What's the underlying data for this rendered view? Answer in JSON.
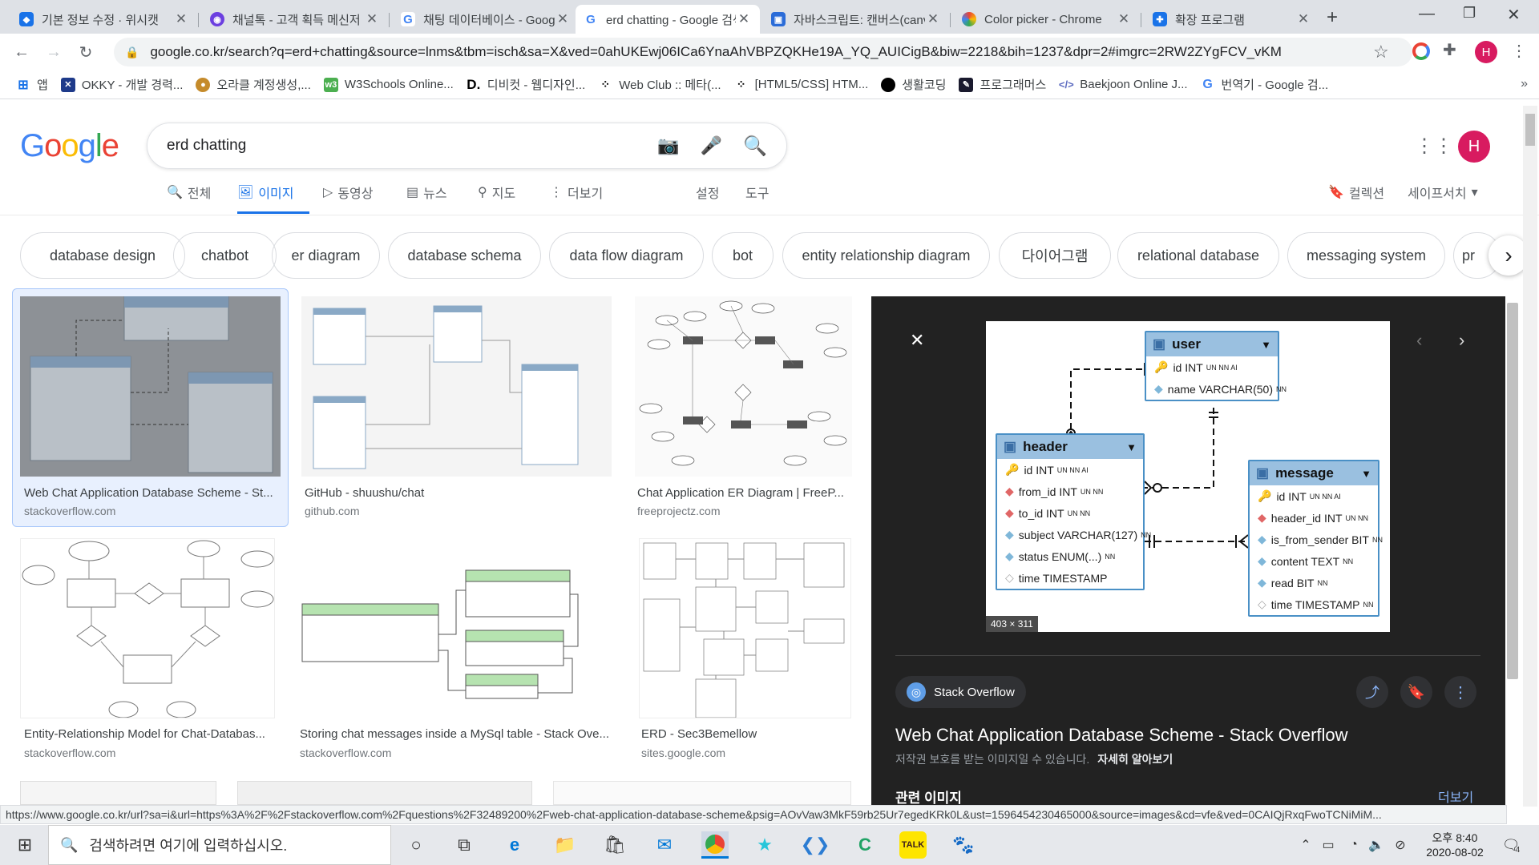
{
  "tabs": [
    {
      "title": "기본 정보 수정 · 위시캣",
      "color": "#1a73e8"
    },
    {
      "title": "채널톡 - 고객 획득 메신저",
      "color": "#6c3fe0"
    },
    {
      "title": "채팅 데이터베이스 - Google",
      "color": "#4285f4"
    },
    {
      "title": "erd chatting - Google 검색",
      "color": "#4285f4"
    },
    {
      "title": "자바스크립트: 캔버스(canvas)",
      "color": "#2b6cd8"
    },
    {
      "title": "Color picker - Chrome",
      "color": "#ea4335"
    },
    {
      "title": "확장 프로그램",
      "color": "#1a73e8"
    }
  ],
  "address": "google.co.kr/search?q=erd+chatting&source=lnms&tbm=isch&sa=X&ved=0ahUKEwj06ICa6YnaAhVBPZQKHe19A_YQ_AUICigB&biw=2218&bih=1237&dpr=2#imgrc=2RW2ZYgFCV_vKM",
  "profile_initial": "H",
  "bookmarks": [
    "앱",
    "OKKY - 개발 경력...",
    "오라클 계정생성,...",
    "W3Schools Online...",
    "디비컷 - 웹디자인...",
    "Web Club :: 메타(...",
    "[HTML5/CSS] HTM...",
    "생활코딩",
    "프로그래머스",
    "Baekjoon Online J...",
    "번역기 - Google 검..."
  ],
  "search": {
    "logo": "Google",
    "query": "erd chatting"
  },
  "menu": [
    "전체",
    "이미지",
    "동영상",
    "뉴스",
    "지도",
    "더보기"
  ],
  "menu_right": [
    "설정",
    "도구"
  ],
  "collections": "컬렉션",
  "safesearch": "세이프서치",
  "chips": [
    "database design",
    "chatbot",
    "er diagram",
    "database schema",
    "data flow diagram",
    "bot",
    "entity relationship diagram",
    "다이어그램",
    "relational database",
    "messaging system",
    "pr"
  ],
  "results": [
    {
      "title": "Web Chat Application Database Scheme - St...",
      "source": "stackoverflow.com"
    },
    {
      "title": "GitHub - shuushu/chat",
      "source": "github.com"
    },
    {
      "title": "Chat Application ER Diagram | FreeP...",
      "source": "freeprojectz.com"
    },
    {
      "title": "Entity-Relationship Model for Chat-Databas...",
      "source": "stackoverflow.com"
    },
    {
      "title": "Storing chat messages inside a MySql table - Stack Ove...",
      "source": "stackoverflow.com"
    },
    {
      "title": "ERD - Sec3Bemellow",
      "source": "sites.google.com"
    }
  ],
  "preview": {
    "dimensions": "403 × 311",
    "source_name": "Stack Overflow",
    "title": "Web Chat Application Database Scheme - Stack Overflow",
    "copyright": "저작권 보호를 받는 이미지일 수 있습니다.",
    "learn_more": "자세히 알아보기",
    "related": "관련 이미지",
    "more": "더보기",
    "tables": {
      "user": {
        "name": "user",
        "rows": [
          "id INT",
          "name VARCHAR(50)"
        ],
        "flags": [
          "UN NN AI",
          "NN"
        ]
      },
      "header": {
        "name": "header",
        "rows": [
          "id INT",
          "from_id INT",
          "to_id INT",
          "subject VARCHAR(127)",
          "status ENUM(...)",
          "time TIMESTAMP"
        ],
        "flags": [
          "UN NN AI",
          "UN NN",
          "UN NN",
          "NN",
          "NN",
          ""
        ]
      },
      "message": {
        "name": "message",
        "rows": [
          "id INT",
          "header_id INT",
          "is_from_sender BIT",
          "content TEXT",
          "read BIT",
          "time TIMESTAMP"
        ],
        "flags": [
          "UN NN AI",
          "UN NN",
          "NN",
          "NN",
          "NN",
          "NN"
        ]
      }
    }
  },
  "status_url": "https://www.google.co.kr/url?sa=i&url=https%3A%2F%2Fstackoverflow.com%2Fquestions%2F32489200%2Fweb-chat-application-database-scheme&psig=AOvVaw3MkF59rb25Ur7egedKRk0L&ust=1596454230465000&source=images&cd=vfe&ved=0CAIQjRxqFwoTCNiMiM...",
  "taskbar": {
    "search_placeholder": "검색하려면 여기에 입력하십시오.",
    "time": "오후 8:40",
    "date": "2020-08-02",
    "notifications": "4"
  }
}
